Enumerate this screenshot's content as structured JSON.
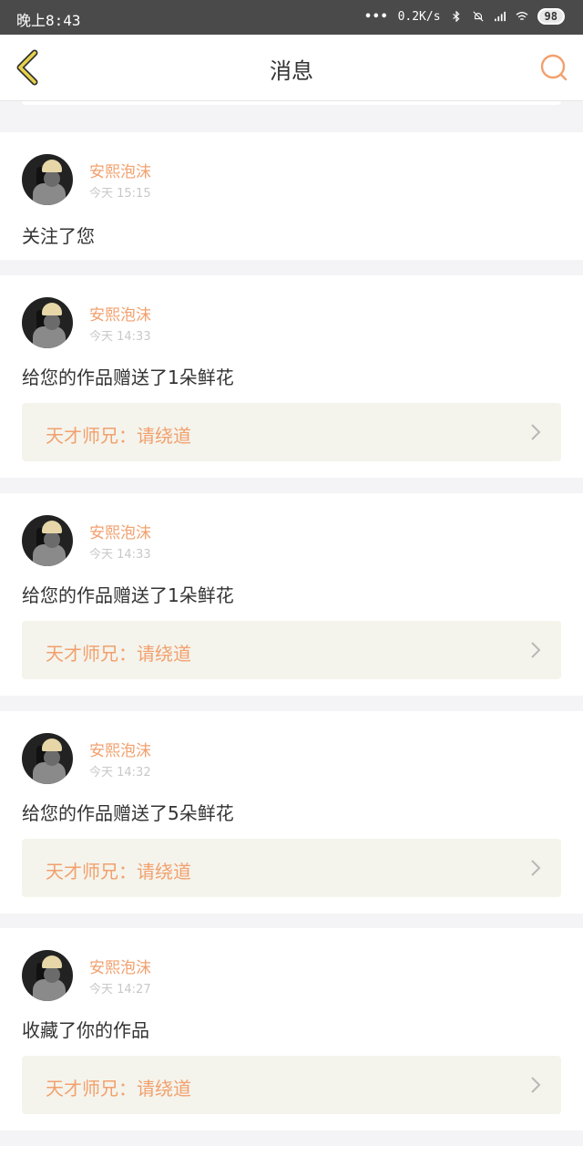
{
  "status_bar": {
    "time": "晚上8:43",
    "network_speed": "0.2K/s",
    "battery_level": "98"
  },
  "nav": {
    "title": "消息"
  },
  "notifications": [
    {
      "username": "安熙泡沫",
      "time": "今天 15:15",
      "message": "关注了您"
    },
    {
      "username": "安熙泡沫",
      "time": "今天 14:33",
      "message": "给您的作品赠送了1朵鲜花",
      "work": "天才师兄：请绕道"
    },
    {
      "username": "安熙泡沫",
      "time": "今天 14:33",
      "message": "给您的作品赠送了1朵鲜花",
      "work": "天才师兄：请绕道"
    },
    {
      "username": "安熙泡沫",
      "time": "今天 14:32",
      "message": "给您的作品赠送了5朵鲜花",
      "work": "天才师兄：请绕道"
    },
    {
      "username": "安熙泡沫",
      "time": "今天 14:27",
      "message": "收藏了你的作品",
      "work": "天才师兄：请绕道"
    }
  ],
  "colors": {
    "accent": "#f2a06e",
    "back_icon": "#e8d24a",
    "status_bar": "#4a4a4a",
    "work_bg": "#f4f4ec"
  }
}
